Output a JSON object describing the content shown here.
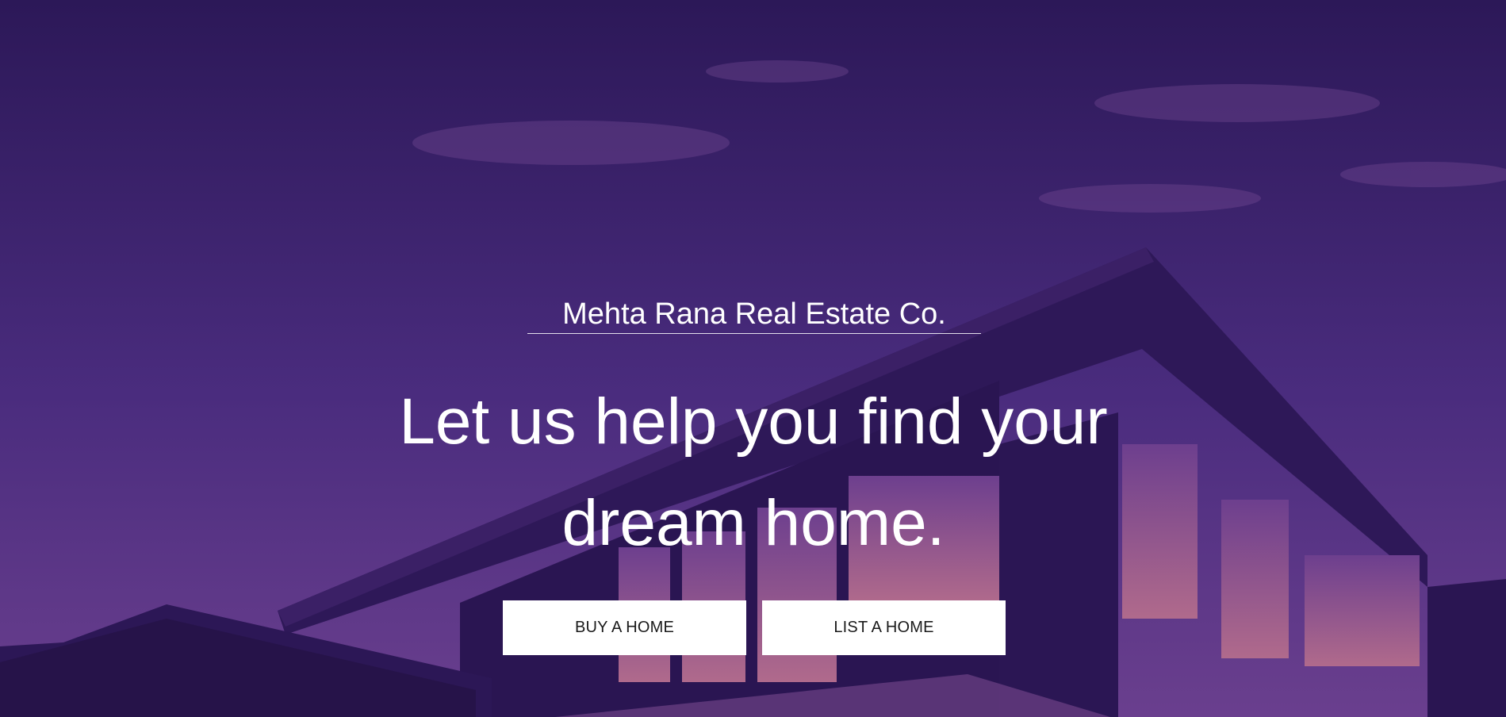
{
  "hero": {
    "brand": "Mehta Rana Real Estate Co.",
    "headline": "Let us help you find your dream home.",
    "buttons": {
      "buy_label": "BUY A HOME",
      "list_label": "LIST A HOME"
    },
    "colors": {
      "overlay": "#3a2168",
      "button_bg": "#ffffff",
      "button_text": "#1a1a1a",
      "text": "#ffffff"
    }
  }
}
